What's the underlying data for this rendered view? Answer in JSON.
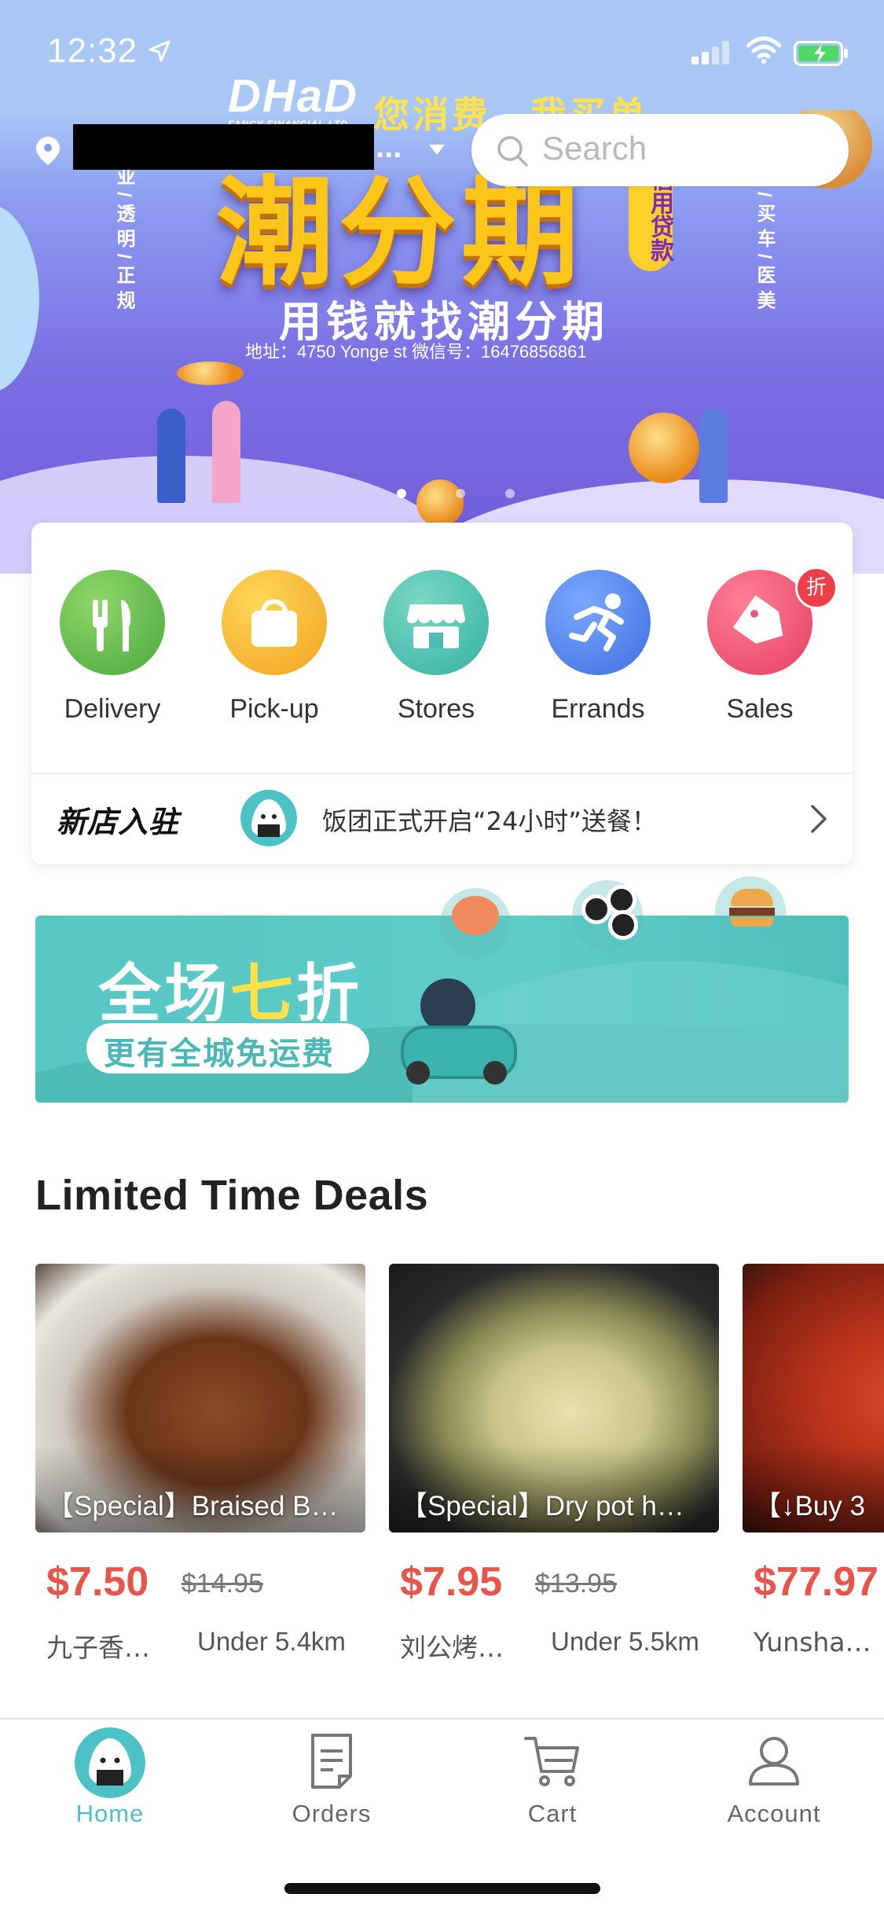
{
  "status_bar": {
    "time": "12:32"
  },
  "location": {
    "ellipsis": "..."
  },
  "search": {
    "placeholder": "Search"
  },
  "hero_banner": {
    "logo_text": "DHaD",
    "logo_subtext": "FANCY FINANCIAL LTD",
    "tagline": "您消费，我买单",
    "title": "潮分期",
    "badge": "信用贷款",
    "slogan": "用钱就找潮分期",
    "address": "地址：4750 Yonge st  微信号：16476856861",
    "left_vertical": "专业/透明/正规",
    "right_vertical": "购物/买车/医美",
    "slide_count": 3,
    "active_slide": 1
  },
  "categories": [
    {
      "label": "Delivery",
      "icon": "fork-knife-icon",
      "color": "#5cba47"
    },
    {
      "label": "Pick-up",
      "icon": "shopping-bag-icon",
      "color": "#f5b324"
    },
    {
      "label": "Stores",
      "icon": "storefront-icon",
      "color": "#3fbfb0"
    },
    {
      "label": "Errands",
      "icon": "runner-icon",
      "color": "#4a82ee"
    },
    {
      "label": "Sales",
      "icon": "price-tag-icon",
      "color": "#f0506a",
      "badge": "折"
    }
  ],
  "news": {
    "tag": "新店入驻",
    "text": "饭团正式开启“24小时”送餐！"
  },
  "promo": {
    "title_a": "全场",
    "title_b": "七",
    "title_c": "折",
    "subtitle": "更有全城免运费"
  },
  "deals": {
    "heading": "Limited Time Deals",
    "items": [
      {
        "name": "【Special】Braised B…",
        "price": "$7.50",
        "old_price": "$14.95",
        "store": "九子香…",
        "distance": "Under 5.4km"
      },
      {
        "name": "【Special】Dry pot h…",
        "price": "$7.95",
        "old_price": "$13.95",
        "store": "刘公烤…",
        "distance": "Under 5.5km"
      },
      {
        "name": "【↓Buy 3",
        "price": "$77.97",
        "old_price": "",
        "store": "Yunsha…",
        "distance": ""
      }
    ]
  },
  "tabs": [
    {
      "label": "Home",
      "icon": "rice-ball-icon",
      "active": true
    },
    {
      "label": "Orders",
      "icon": "document-icon",
      "active": false
    },
    {
      "label": "Cart",
      "icon": "cart-icon",
      "active": false
    },
    {
      "label": "Account",
      "icon": "person-icon",
      "active": false
    }
  ],
  "colors": {
    "accent": "#4cc2c6",
    "price": "#e8554a",
    "promo_bg": "#5ccac5"
  }
}
